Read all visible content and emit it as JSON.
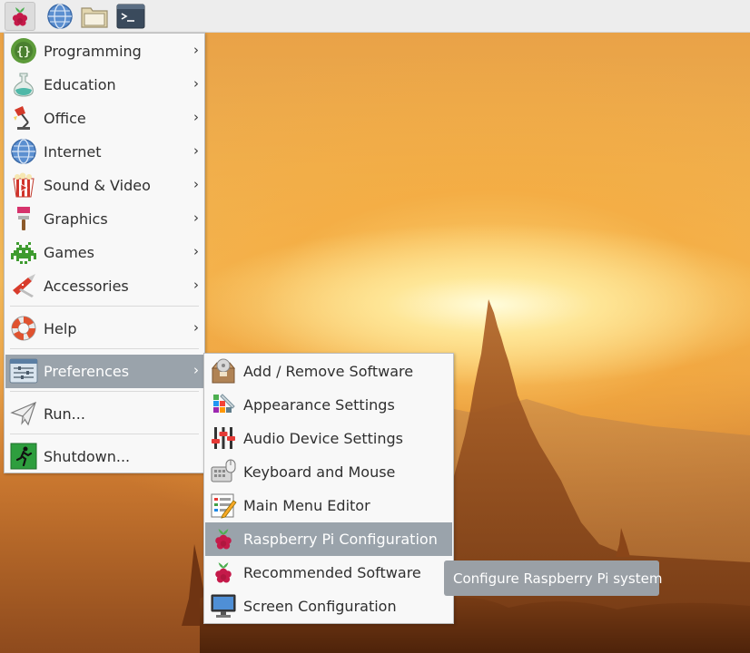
{
  "taskbar": {
    "launchers": [
      {
        "name": "Menu",
        "icon": "raspberry-icon"
      },
      {
        "name": "Web Browser",
        "icon": "globe-icon"
      },
      {
        "name": "File Manager",
        "icon": "folder-icon"
      },
      {
        "name": "Terminal",
        "icon": "terminal-icon"
      }
    ]
  },
  "main_menu": {
    "items": [
      {
        "label": "Programming",
        "icon": "code-braces-icon",
        "has_submenu": true
      },
      {
        "label": "Education",
        "icon": "flask-icon",
        "has_submenu": true
      },
      {
        "label": "Office",
        "icon": "desk-lamp-icon",
        "has_submenu": true
      },
      {
        "label": "Internet",
        "icon": "globe-icon",
        "has_submenu": true
      },
      {
        "label": "Sound & Video",
        "icon": "popcorn-icon",
        "has_submenu": true
      },
      {
        "label": "Graphics",
        "icon": "paintbrush-icon",
        "has_submenu": true
      },
      {
        "label": "Games",
        "icon": "space-invader-icon",
        "has_submenu": true
      },
      {
        "label": "Accessories",
        "icon": "pocket-knife-icon",
        "has_submenu": true
      },
      {
        "label": "Help",
        "icon": "lifebuoy-icon",
        "has_submenu": true
      },
      {
        "label": "Preferences",
        "icon": "settings-sliders-icon",
        "has_submenu": true,
        "highlighted": true
      },
      {
        "label": "Run...",
        "icon": "paper-plane-icon",
        "has_submenu": false
      },
      {
        "label": "Shutdown...",
        "icon": "exit-runner-icon",
        "has_submenu": false
      }
    ]
  },
  "preferences_submenu": {
    "items": [
      {
        "label": "Add / Remove Software",
        "icon": "package-disc-icon"
      },
      {
        "label": "Appearance Settings",
        "icon": "color-swatch-icon"
      },
      {
        "label": "Audio Device Settings",
        "icon": "audio-sliders-icon"
      },
      {
        "label": "Keyboard and Mouse",
        "icon": "keyboard-mouse-icon"
      },
      {
        "label": "Main Menu Editor",
        "icon": "menu-editor-icon"
      },
      {
        "label": "Raspberry Pi Configuration",
        "icon": "raspberry-icon",
        "highlighted": true
      },
      {
        "label": "Recommended Software",
        "icon": "raspberry-icon"
      },
      {
        "label": "Screen Configuration",
        "icon": "monitor-icon"
      }
    ]
  },
  "tooltip": {
    "text": "Configure Raspberry Pi system"
  },
  "colors": {
    "highlight": "#9aa3ab",
    "menu_bg": "#f8f8f8",
    "tooltip_bg": "#9aa0a6",
    "raspberry": "#c51a4a",
    "leaf": "#4caf50"
  }
}
